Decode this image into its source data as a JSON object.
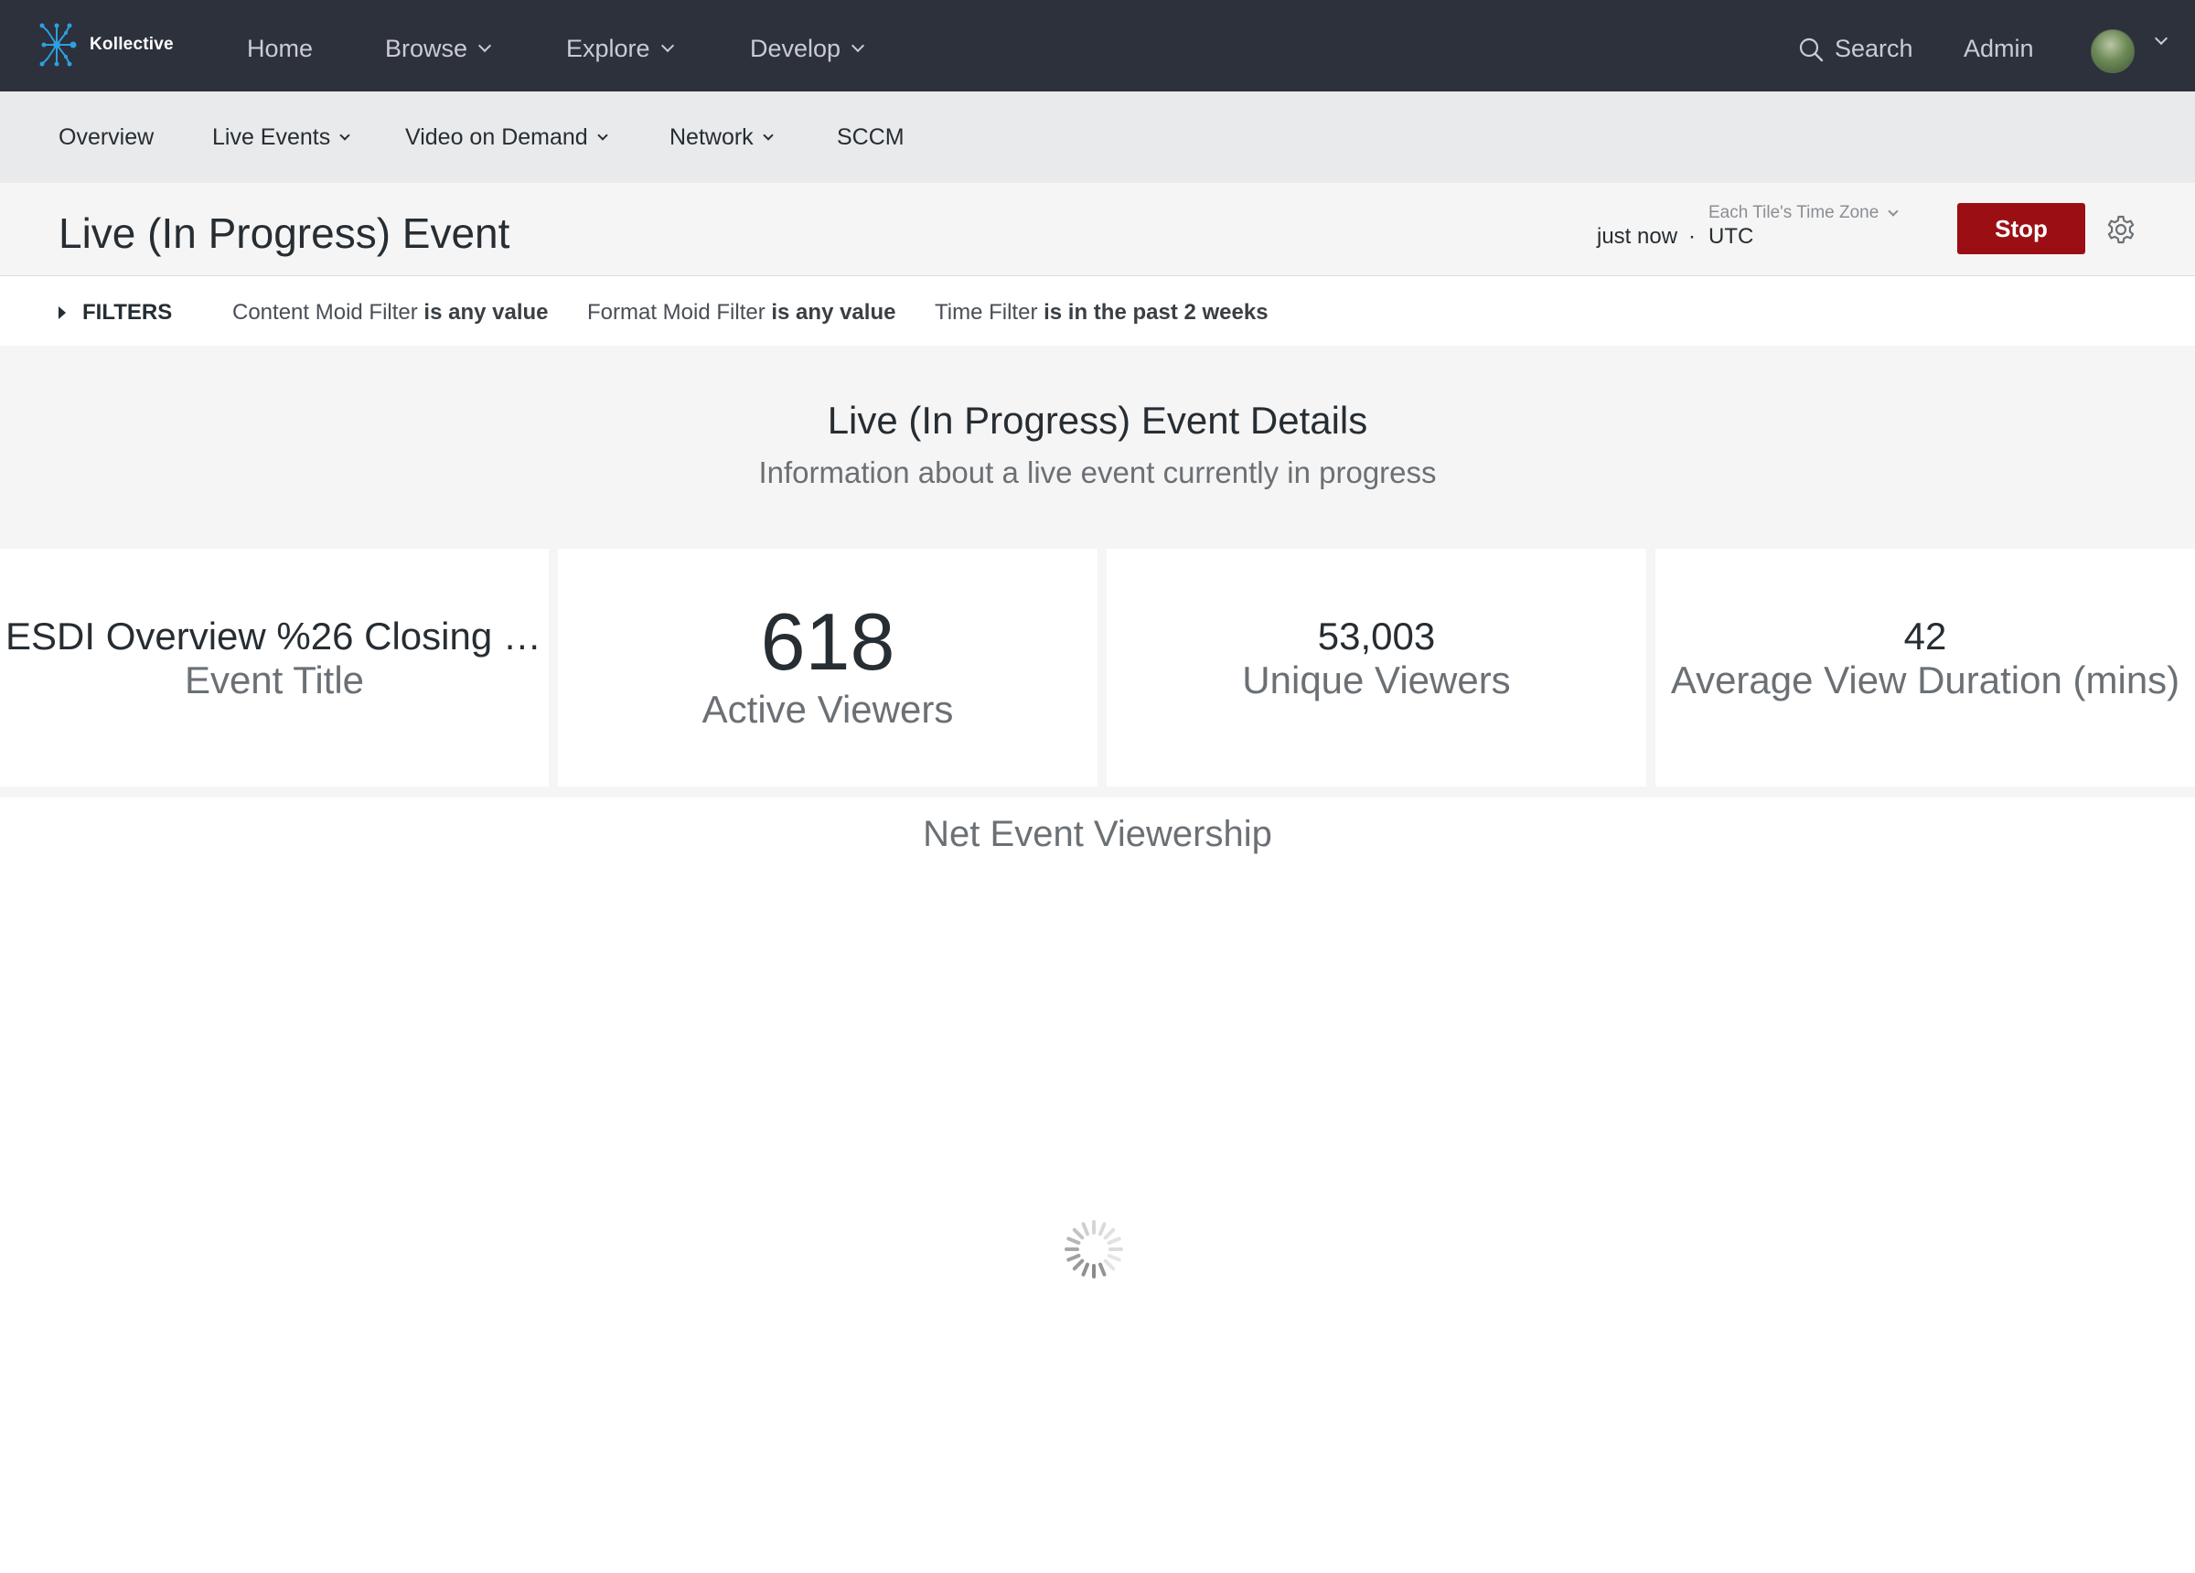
{
  "brand": {
    "name": "Kollective",
    "logo": "kollective-logo"
  },
  "topnav": {
    "items": [
      {
        "label": "Home",
        "has_dropdown": false
      },
      {
        "label": "Browse",
        "has_dropdown": true
      },
      {
        "label": "Explore",
        "has_dropdown": true
      },
      {
        "label": "Develop",
        "has_dropdown": true
      }
    ],
    "search_label": "Search",
    "admin_label": "Admin",
    "avatar": "user-avatar"
  },
  "subnav": {
    "items": [
      {
        "label": "Overview",
        "has_dropdown": false
      },
      {
        "label": "Live Events",
        "has_dropdown": true
      },
      {
        "label": "Video on Demand",
        "has_dropdown": true
      },
      {
        "label": "Network",
        "has_dropdown": true
      },
      {
        "label": "SCCM",
        "has_dropdown": false
      }
    ]
  },
  "header": {
    "title": "Live (In Progress) Event",
    "timezone_label": "Each Tile's Time Zone",
    "updated": "just now",
    "separator": "·",
    "timezone": "UTC",
    "stop_label": "Stop",
    "settings_icon": "gear-icon",
    "stop_color": "#9b0f14"
  },
  "filters": {
    "toggle_label": "FILTERS",
    "items": [
      {
        "name": "Content Moid Filter",
        "condition": "is any value"
      },
      {
        "name": "Format Moid Filter",
        "condition": "is any value"
      },
      {
        "name": "Time Filter",
        "condition": "is in the past 2 weeks"
      }
    ]
  },
  "dashboard": {
    "section_title": "Live (In Progress) Event Details",
    "section_subtitle": "Information about a live event currently in progress",
    "tiles": [
      {
        "value": "ESDI Overview %26 Closing Ses...",
        "label": "Event Title"
      },
      {
        "value": "618",
        "label": "Active Viewers"
      },
      {
        "value": "53,003",
        "label": "Unique Viewers"
      },
      {
        "value": "42",
        "label": "Average View Duration (mins)"
      }
    ],
    "chart_tile": {
      "title": "Net Event Viewership",
      "state": "loading",
      "loader_icon": "loading-spinner-icon"
    }
  },
  "colors": {
    "topnav_bg": "#2c313c",
    "subnav_bg": "#e9eaeb",
    "page_bg": "#f5f5f5",
    "accent_blue": "#2f9fe0"
  }
}
